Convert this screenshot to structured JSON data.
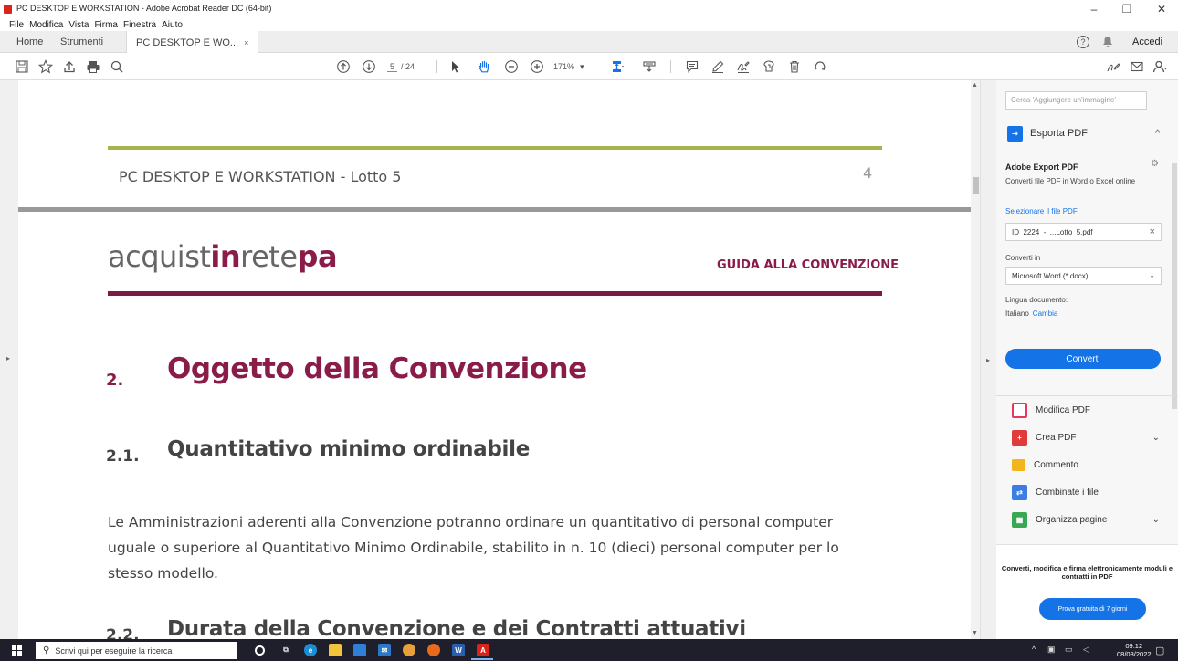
{
  "window": {
    "title": "PC DESKTOP E WORKSTATION - Adobe Acrobat Reader DC (64-bit)",
    "minimize": "–",
    "maximize": "❐",
    "close": "✕"
  },
  "menu": [
    "File",
    "Modifica",
    "Vista",
    "Firma",
    "Finestra",
    "Aiuto"
  ],
  "tabs": {
    "home": "Home",
    "tools": "Strumenti",
    "document": "PC DESKTOP E WO...",
    "document_close": "×",
    "help_icon": "?",
    "signin": "Accedi"
  },
  "toolbar": {
    "page_current": "5",
    "page_total": "/ 24",
    "zoom": "171%",
    "zoom_caret": "▾"
  },
  "document": {
    "header_title": "PC DESKTOP E WORKSTATION - Lotto 5",
    "header_page": "4",
    "logo_part1": "acquist",
    "logo_part2": "in",
    "logo_part3": "rete",
    "logo_part4": "pa",
    "guide_label": "GUIDA ALLA CONVENZIONE",
    "section_num": "2.",
    "section_title": "Oggetto della Convenzione",
    "sub1_num": "2.1.",
    "sub1_title": "Quantitativo minimo ordinabile",
    "para_line1": "Le Amministrazioni aderenti alla Convenzione potranno ordinare un quantitativo di personal computer",
    "para_line2": "uguale o superiore al Quantitativo Minimo Ordinabile, stabilito in n. 10 (dieci) personal computer per lo",
    "para_line3": "stesso modello.",
    "sub2_num": "2.2.",
    "sub2_title": "Durata della Convenzione e dei Contratti attuativi"
  },
  "right_panel": {
    "search_placeholder": "Cerca 'Aggiungere un'immagine'",
    "export_header": "Esporta PDF",
    "export_title": "Adobe Export PDF",
    "export_desc": "Converti file PDF in Word o Excel online",
    "select_file_link": "Selezionare il file PDF",
    "file_name": "ID_2224_-_...Lotto_5.pdf",
    "convert_to_label": "Converti in",
    "format_value": "Microsoft Word (*.docx)",
    "language_label": "Lingua documento:",
    "language_value": "Italiano",
    "language_change": "Cambia",
    "convert_button": "Converti",
    "tools": [
      {
        "label": "Modifica PDF",
        "icon": "edit-pdf-icon",
        "color": "#e03a5c"
      },
      {
        "label": "Crea PDF",
        "icon": "create-pdf-icon",
        "color": "#e03a3a"
      },
      {
        "label": "Commento",
        "icon": "comment-icon",
        "color": "#f2b51c"
      },
      {
        "label": "Combinate i file",
        "icon": "combine-files-icon",
        "color": "#3b7de0"
      },
      {
        "label": "Organizza pagine",
        "icon": "organize-pages-icon",
        "color": "#3aa853"
      }
    ],
    "promo_text": "Converti, modifica e firma elettronicamente moduli e contratti in PDF",
    "trial_button": "Prova gratuita di 7 giorni"
  },
  "taskbar": {
    "search_placeholder": "Scrivi qui per eseguire la ricerca",
    "time": "09:12",
    "date": "08/03/2022"
  },
  "colors": {
    "accent_blue": "#1473e6",
    "brand_maroon": "#8a1c4a",
    "rule_green": "#a6b34e",
    "taskbar": "#1f1f2b"
  }
}
